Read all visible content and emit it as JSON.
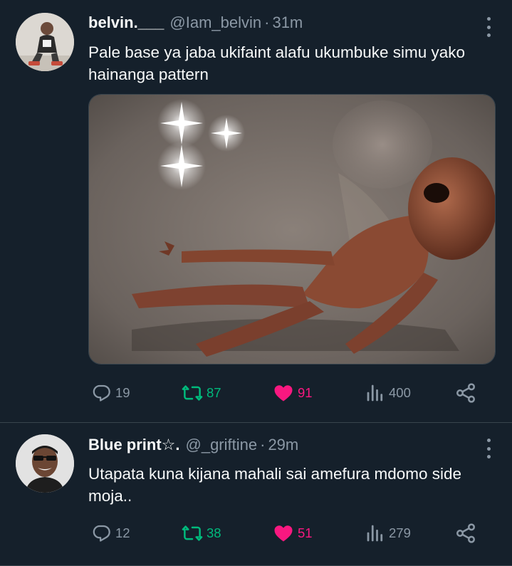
{
  "tweets": [
    {
      "name": "belvin.___",
      "handle": "@Iam_belvin",
      "separator": "·",
      "time": "31m",
      "text": "Pale base ya jaba ukifaint alafu ukumbuke simu yako hainanga pattern",
      "replies": "19",
      "retweets": "87",
      "likes": "91",
      "views": "400"
    },
    {
      "name": "Blue print☆.",
      "handle": "@_griftine",
      "separator": "·",
      "time": "29m",
      "text": "Utapata kuna kijana mahali sai amefura mdomo side moja..",
      "replies": "12",
      "retweets": "38",
      "likes": "51",
      "views": "279"
    }
  ],
  "colors": {
    "background": "#15202b",
    "muted": "#8b98a5",
    "retweet_active": "#00ba7c",
    "like_active": "#f91880",
    "divider": "#38444d"
  },
  "icons": [
    "more-icon",
    "reply-icon",
    "retweet-icon",
    "heart-icon",
    "views-icon",
    "share-icon"
  ]
}
